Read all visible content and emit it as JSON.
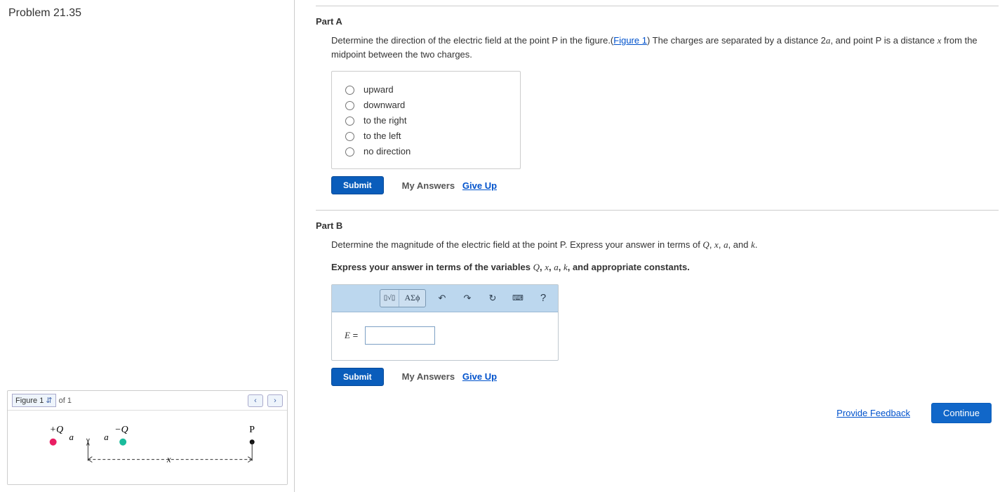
{
  "problem_title": "Problem 21.35",
  "figure": {
    "selector_label": "Figure 1",
    "of_text": "of 1",
    "labels": {
      "posQ": "+Q",
      "negQ": "−Q",
      "a": "a",
      "x": "x",
      "P": "P"
    }
  },
  "partA": {
    "title": "Part A",
    "prompt_pre": "Determine the direction of the electric field at the point P in the figure.(",
    "fig_link": "Figure 1",
    "prompt_mid": ") The charges are separated by a distance 2",
    "var_a": "a",
    "prompt_mid2": ", and point P is a distance ",
    "var_x": "x",
    "prompt_end": " from the midpoint between the two charges.",
    "options": [
      "upward",
      "downward",
      "to the right",
      "to the left",
      "no direction"
    ],
    "submit": "Submit",
    "my_answers": "My Answers",
    "give_up": "Give Up"
  },
  "partB": {
    "title": "Part B",
    "prompt_pre": "Determine the magnitude of the electric field at the point P. Express your answer in terms of ",
    "vars_list": "Q, x, a, k",
    "prompt_post": ".",
    "instr_pre": "Express your answer in terms of the variables ",
    "instr_post": ", and appropriate constants.",
    "toolbar": {
      "templates": "▯√▯",
      "greek": "ΑΣϕ",
      "undo": "↶",
      "redo": "↷",
      "reset": "↻",
      "keyboard": "⌨",
      "help": "?"
    },
    "eq_label": "E",
    "eq_equals": " = ",
    "submit": "Submit",
    "my_answers": "My Answers",
    "give_up": "Give Up"
  },
  "footer": {
    "feedback": "Provide Feedback",
    "continue": "Continue"
  }
}
